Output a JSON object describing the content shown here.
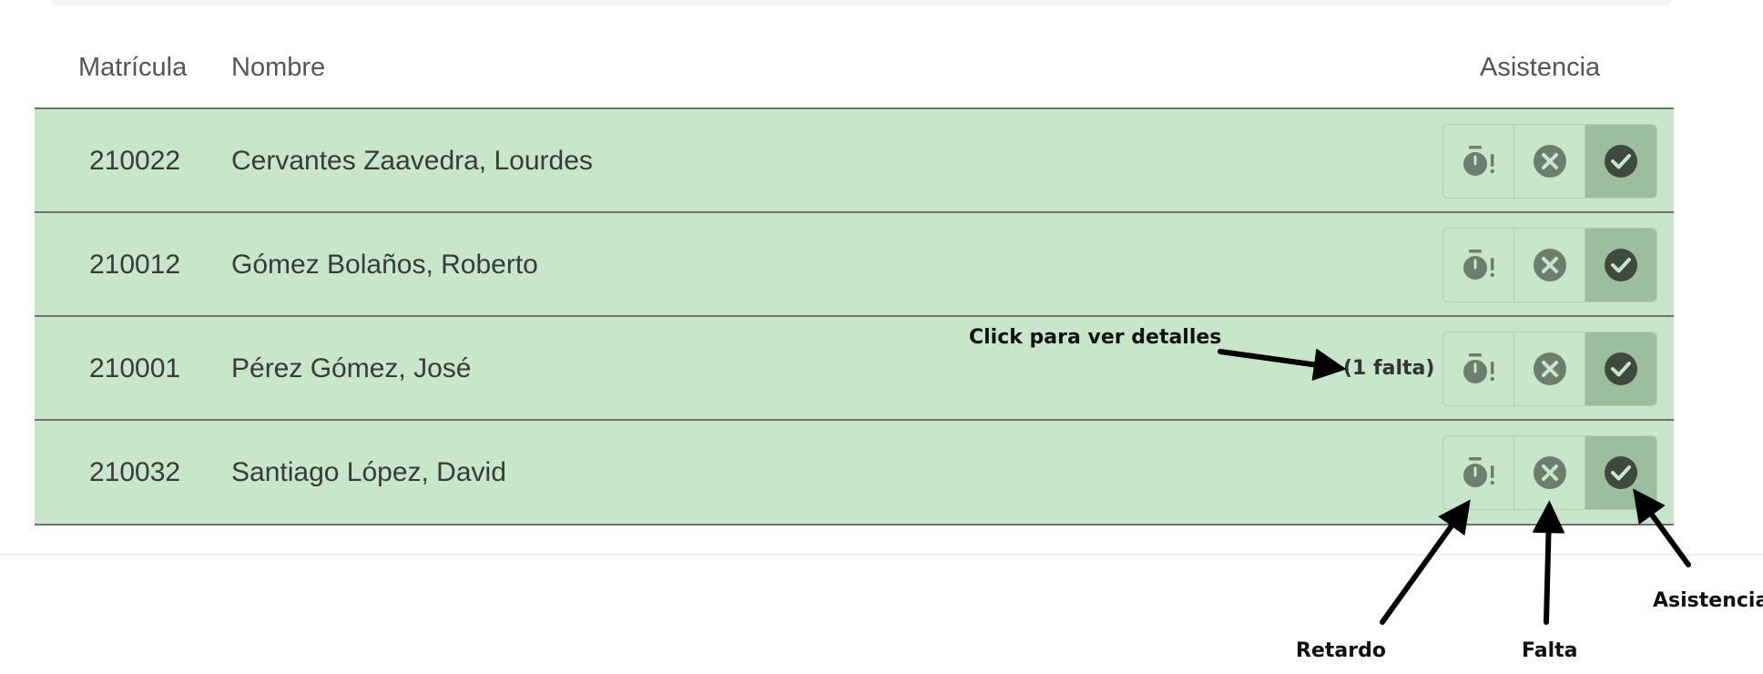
{
  "table": {
    "headers": {
      "matricula": "Matrícula",
      "nombre": "Nombre",
      "asistencia": "Asistencia"
    },
    "rows": [
      {
        "matricula": "210022",
        "nombre": "Cervantes Zaavedra, Lourdes",
        "note": "",
        "selected": "asistencia"
      },
      {
        "matricula": "210012",
        "nombre": "Gómez Bolaños, Roberto",
        "note": "",
        "selected": "asistencia"
      },
      {
        "matricula": "210001",
        "nombre": "Pérez Gómez, José",
        "note": "(1 falta)",
        "selected": "asistencia"
      },
      {
        "matricula": "210032",
        "nombre": "Santiago López, David",
        "note": "",
        "selected": "asistencia"
      }
    ]
  },
  "annotations": {
    "click_details": "Click para ver detalles",
    "retardo": "Retardo",
    "falta": "Falta",
    "asistencia": "Asistencia"
  },
  "colors": {
    "row_background": "#c8e6c9",
    "active_button": "#9bbf9d",
    "icon": "#6e7d6e",
    "icon_active": "#3d4a3d"
  },
  "icons": {
    "retardo": "late-stopwatch-icon",
    "falta": "cancel-circle-icon",
    "asistencia": "check-circle-icon"
  }
}
